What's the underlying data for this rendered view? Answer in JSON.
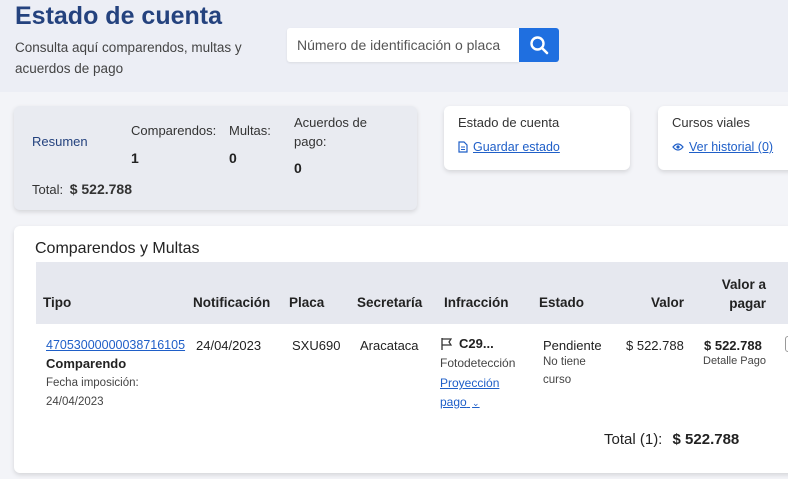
{
  "header": {
    "title": "Estado de cuenta",
    "subtitle": "Consulta aquí comparendos, multas y acuerdos de pago",
    "search_placeholder": "Número de identificación o placa",
    "search_icon": "search-icon"
  },
  "summary": {
    "label": "Resumen",
    "comparendos_label": "Comparendos:",
    "comparendos_value": "1",
    "multas_label": "Multas:",
    "multas_value": "0",
    "acuerdos_label": "Acuerdos de pago:",
    "acuerdos_value": "0",
    "total_label": "Total:",
    "total_value": "$ 522.788"
  },
  "estado_card": {
    "title": "Estado de cuenta",
    "link": "Guardar estado",
    "icon": "document-icon"
  },
  "cursos_card": {
    "title": "Cursos viales",
    "link": "Ver historial (0)",
    "icon": "eye-icon"
  },
  "table": {
    "title": "Comparendos y Multas",
    "headers": {
      "tipo": "Tipo",
      "notificacion": "Notificación",
      "placa": "Placa",
      "secretaria": "Secretaría",
      "infraccion": "Infracción",
      "estado": "Estado",
      "valor": "Valor",
      "valor_pagar": "Valor a pagar"
    },
    "rows": [
      {
        "numero": "47053000000038716105",
        "tipo": "Comparendo",
        "fecha_imposicion": "Fecha imposición: 24/04/2023",
        "notificacion": "24/04/2023",
        "placa": "SXU690",
        "secretaria": "Aracataca",
        "infraccion_codigo": "C29...",
        "infraccion_tipo": "Fotodetección",
        "proyeccion": "Proyección pago",
        "estado": "Pendiente",
        "curso": "No tiene curso",
        "valor": "$ 522.788",
        "valor_pagar": "$ 522.788",
        "detalle": "Detalle Pago"
      }
    ],
    "total_label": "Total (1):",
    "total_value": "$ 522.788"
  },
  "colors": {
    "title": "#24427e",
    "accent": "#1f6fe0",
    "link": "#1f5fc8"
  }
}
